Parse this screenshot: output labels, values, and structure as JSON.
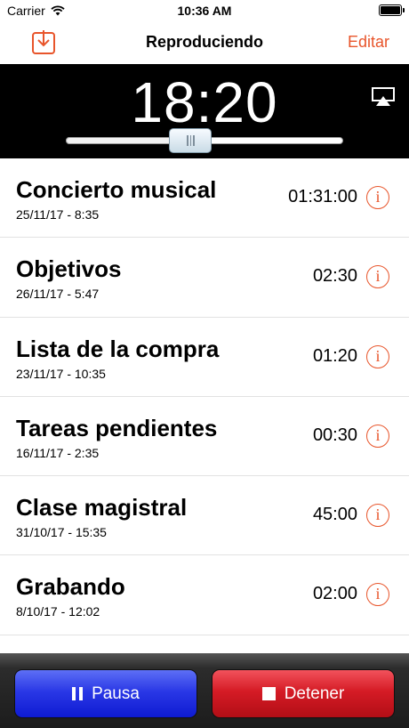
{
  "status_bar": {
    "carrier": "Carrier",
    "time": "10:36 AM"
  },
  "nav": {
    "title": "Reproduciendo",
    "edit_label": "Editar",
    "left_icon": "download-tray-icon"
  },
  "player": {
    "time_display": "18:20",
    "progress": 0.45
  },
  "recordings": [
    {
      "title": "Concierto musical",
      "date": "25/11/17 - 8:35",
      "duration": "01:31:00"
    },
    {
      "title": "Objetivos",
      "date": "26/11/17 - 5:47",
      "duration": "02:30"
    },
    {
      "title": "Lista de la compra",
      "date": "23/11/17 - 10:35",
      "duration": "01:20"
    },
    {
      "title": "Tareas pendientes",
      "date": "16/11/17 - 2:35",
      "duration": "00:30"
    },
    {
      "title": "Clase magistral",
      "date": "31/10/17 - 15:35",
      "duration": "45:00"
    },
    {
      "title": "Grabando",
      "date": "8/10/17 - 12:02",
      "duration": "02:00"
    }
  ],
  "info_glyph": "i",
  "toolbar": {
    "pause_label": "Pausa",
    "stop_label": "Detener"
  },
  "colors": {
    "accent": "#e8552b",
    "pause": "#1a27dc",
    "stop": "#c8141d",
    "header": "#000000"
  }
}
